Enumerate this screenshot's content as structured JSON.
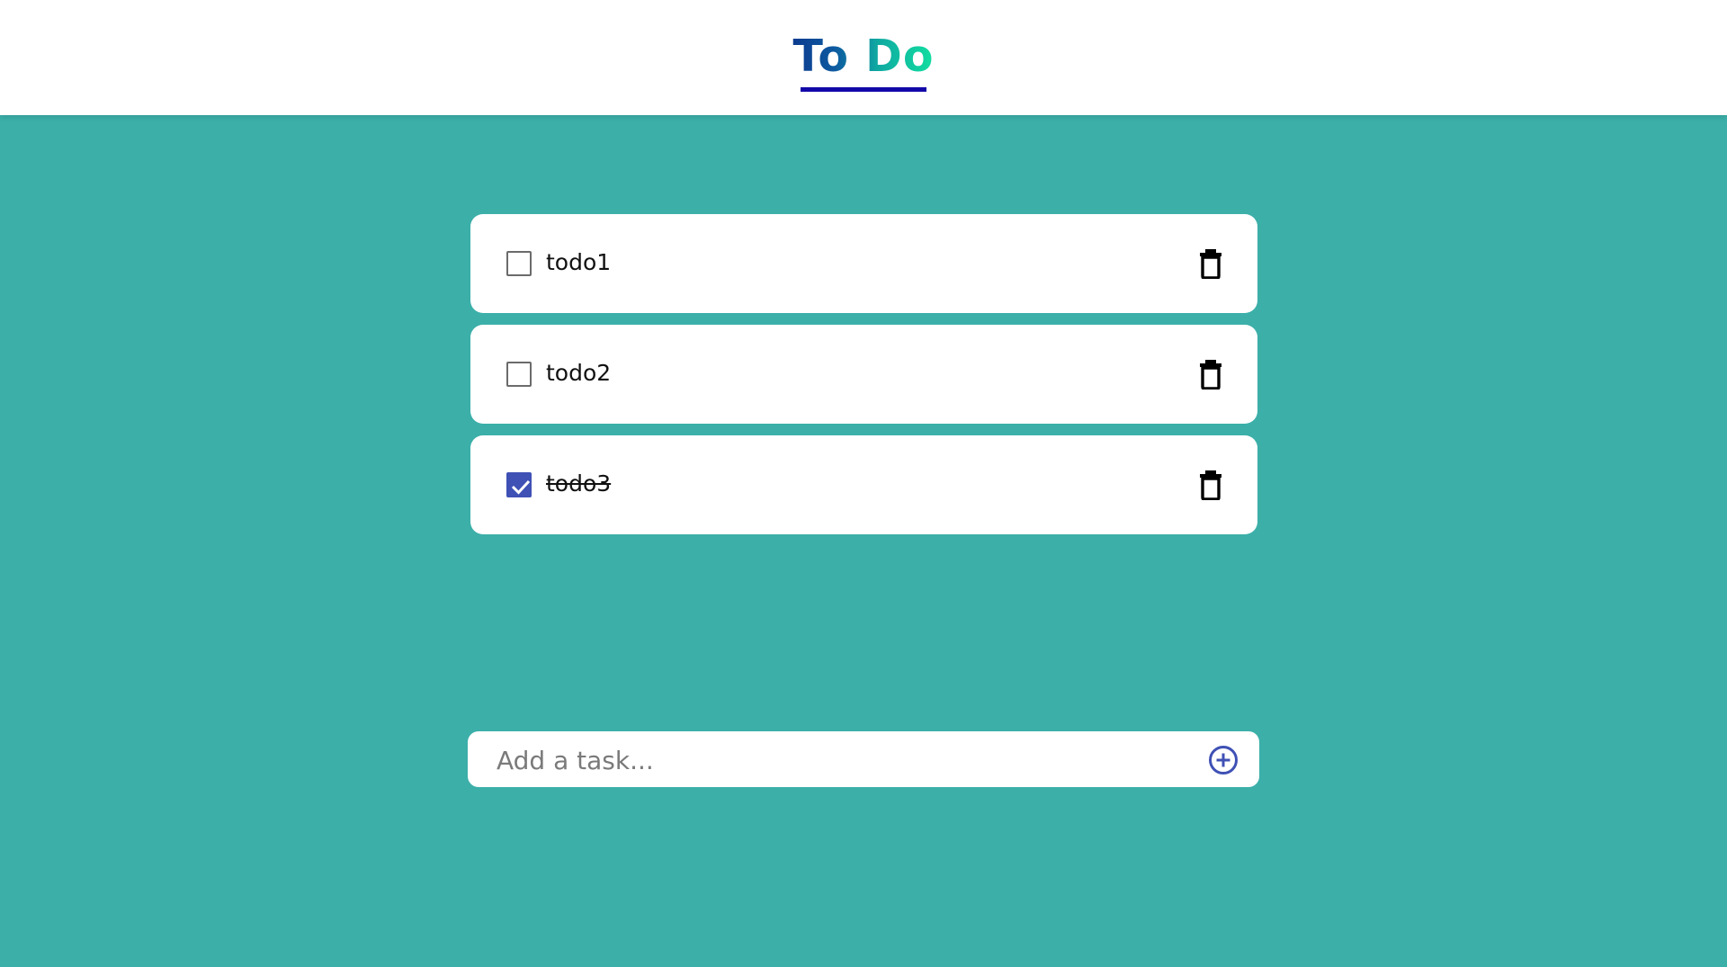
{
  "header": {
    "title": "To Do"
  },
  "todos": [
    {
      "text": "todo1",
      "done": false
    },
    {
      "text": "todo2",
      "done": false
    },
    {
      "text": "todo3",
      "done": true
    }
  ],
  "add_task": {
    "placeholder": "Add a task..."
  },
  "colors": {
    "background": "#3cafa9",
    "accent": "#3f51b5",
    "underline": "#1208a8",
    "title_gradient_start": "#0b3a8e",
    "title_gradient_end": "#12e0a0"
  },
  "icons": {
    "delete": "trash-icon",
    "add": "plus-circle-icon",
    "checked": "checkmark-icon"
  }
}
